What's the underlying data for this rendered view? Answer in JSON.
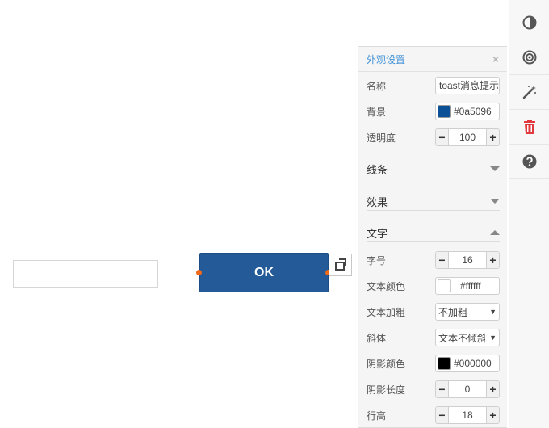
{
  "canvas": {
    "ok_label": "OK"
  },
  "panel": {
    "title": "外观设置",
    "close_glyph": "×",
    "name": {
      "label": "名称",
      "value": "toast消息提示"
    },
    "background": {
      "label": "背景",
      "value": "#0a5096",
      "swatch": "#0a5096"
    },
    "opacity": {
      "label": "透明度",
      "value": "100"
    },
    "sections": {
      "line": "线条",
      "effect": "效果",
      "text": "文字"
    },
    "font_size": {
      "label": "字号",
      "value": "16"
    },
    "text_color": {
      "label": "文本颜色",
      "value": "#ffffff",
      "swatch": "#ffffff"
    },
    "text_bold": {
      "label": "文本加粗",
      "value": "不加粗"
    },
    "italic": {
      "label": "斜体",
      "value": "文本不倾斜"
    },
    "shadow_color": {
      "label": "阴影颜色",
      "value": "#000000",
      "swatch": "#000000"
    },
    "shadow_length": {
      "label": "阴影长度",
      "value": "0"
    },
    "line_height": {
      "label": "行高",
      "value": "18"
    },
    "minus": "−",
    "plus": "+"
  },
  "toolbar": {
    "icons": [
      "contrast-icon",
      "target-icon",
      "magic-wand-icon",
      "trash-icon",
      "help-icon"
    ]
  },
  "colors": {
    "accent": "#3d8fd6",
    "button_fill": "#245a97",
    "handle": "#f06a1a",
    "trash": "#e0393e"
  }
}
